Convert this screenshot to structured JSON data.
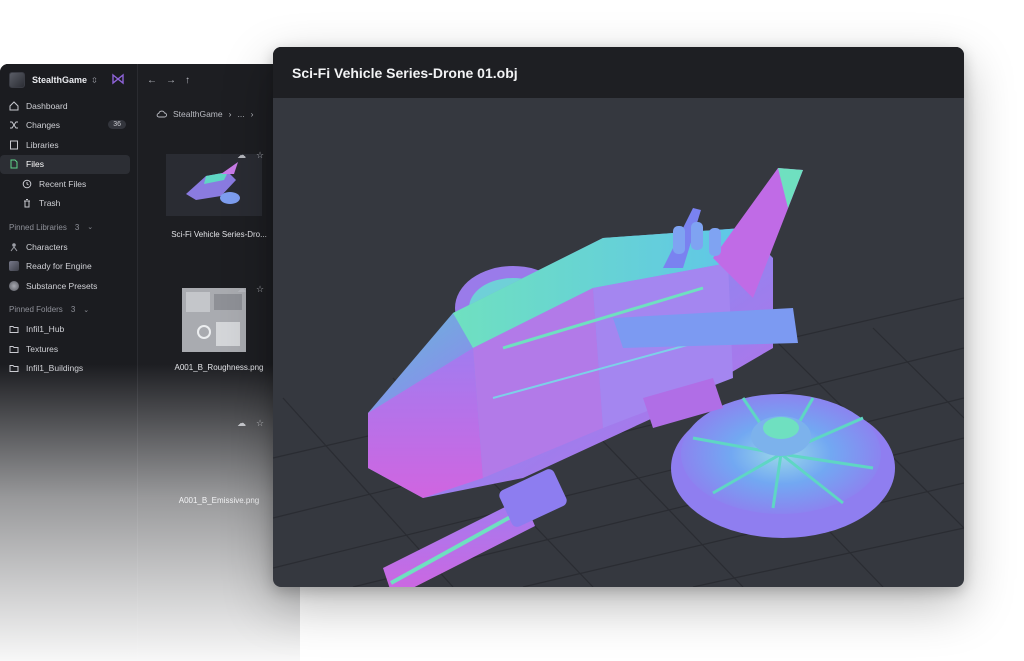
{
  "workspace": {
    "name": "StealthGame"
  },
  "nav": {
    "dashboard": "Dashboard",
    "changes": "Changes",
    "changes_count": "36",
    "libraries": "Libraries",
    "files": "Files",
    "recent_files": "Recent Files",
    "trash": "Trash"
  },
  "pinned_libraries": {
    "title": "Pinned Libraries",
    "count": "3",
    "items": [
      "Characters",
      "Ready for Engine",
      "Substance Presets"
    ]
  },
  "pinned_folders": {
    "title": "Pinned Folders",
    "count": "3",
    "items": [
      "Infil1_Hub",
      "Textures",
      "Infil1_Buildings"
    ]
  },
  "breadcrumb": {
    "root": "StealthGame",
    "ellipsis": "..."
  },
  "files": [
    {
      "label": "Sci-Fi Vehicle Series-Dro..."
    },
    {
      "label": "A001_B_Roughness.png"
    },
    {
      "label": "A001_B_Emissive.png"
    }
  ],
  "preview": {
    "title": "Sci-Fi Vehicle Series-Drone 01.obj"
  },
  "colors": {
    "accent_logo": "#8e63d8",
    "preview_bg": "#35383f",
    "header_bg": "#1e1f23"
  }
}
